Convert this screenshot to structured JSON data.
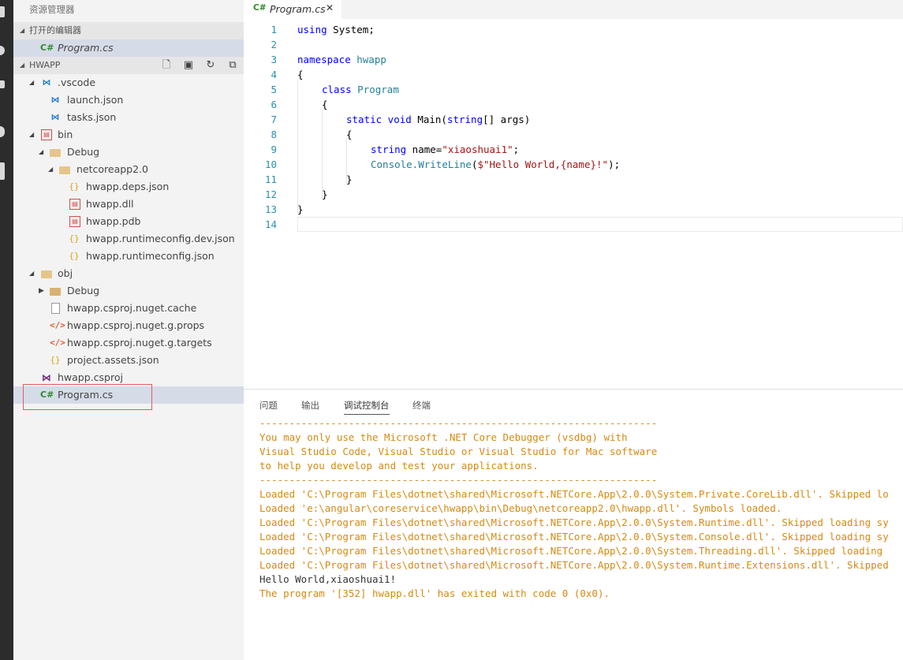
{
  "sidebar": {
    "title": "资源管理器",
    "open_editors": {
      "header": "打开的编辑器",
      "items": [
        {
          "label": "Program.cs"
        }
      ]
    },
    "project": {
      "header": "HWAPP",
      "tree": [
        {
          "label": ".vscode"
        },
        {
          "label": "launch.json"
        },
        {
          "label": "tasks.json"
        },
        {
          "label": "bin"
        },
        {
          "label": "Debug"
        },
        {
          "label": "netcoreapp2.0"
        },
        {
          "label": "hwapp.deps.json"
        },
        {
          "label": "hwapp.dll"
        },
        {
          "label": "hwapp.pdb"
        },
        {
          "label": "hwapp.runtimeconfig.dev.json"
        },
        {
          "label": "hwapp.runtimeconfig.json"
        },
        {
          "label": "obj"
        },
        {
          "label": "Debug"
        },
        {
          "label": "hwapp.csproj.nuget.cache"
        },
        {
          "label": "hwapp.csproj.nuget.g.props"
        },
        {
          "label": "hwapp.csproj.nuget.g.targets"
        },
        {
          "label": "project.assets.json"
        },
        {
          "label": "hwapp.csproj"
        },
        {
          "label": "Program.cs"
        }
      ]
    }
  },
  "editor": {
    "tab": {
      "label": "Program.cs",
      "icon": "C#",
      "close": "✕"
    },
    "line_numbers": [
      "1",
      "2",
      "3",
      "4",
      "5",
      "6",
      "7",
      "8",
      "9",
      "10",
      "11",
      "12",
      "13",
      "14"
    ],
    "code": {
      "l1_kw": "using",
      "l1_rest": " System;",
      "l3_kw": "namespace",
      "l3_rest": " hwapp",
      "l4": "{",
      "l5_kw": "class",
      "l5_type": " Program",
      "l6": "{",
      "l7_kw1": "static",
      "l7_kw2": " void",
      "l7_name": " Main(",
      "l7_kw3": "string",
      "l7_rest": "[] args)",
      "l8": "{",
      "l9_kw": "string",
      "l9_name": " name=",
      "l9_str": "\"xiaoshuai1\"",
      "l9_end": ";",
      "l10_obj": "Console.",
      "l10_method": "WriteLine",
      "l10_open": "(",
      "l10_str": "$\"Hello World,{name}!\"",
      "l10_end": ");",
      "l11": "}",
      "l12": "}",
      "l13": "}"
    }
  },
  "panel": {
    "tabs": [
      "问题",
      "输出",
      "调试控制台",
      "终端"
    ],
    "active_tab": "调试控制台",
    "output": [
      "-------------------------------------------------------------------",
      "You may only use the Microsoft .NET Core Debugger (vsdbg) with",
      "Visual Studio Code, Visual Studio or Visual Studio for Mac software",
      "to help you develop and test your applications.",
      "-------------------------------------------------------------------",
      "Loaded 'C:\\Program Files\\dotnet\\shared\\Microsoft.NETCore.App\\2.0.0\\System.Private.CoreLib.dll'. Skipped lo",
      "Loaded 'e:\\angular\\coreservice\\hwapp\\bin\\Debug\\netcoreapp2.0\\hwapp.dll'. Symbols loaded.",
      "Loaded 'C:\\Program Files\\dotnet\\shared\\Microsoft.NETCore.App\\2.0.0\\System.Runtime.dll'. Skipped loading sy",
      "Loaded 'C:\\Program Files\\dotnet\\shared\\Microsoft.NETCore.App\\2.0.0\\System.Console.dll'. Skipped loading sy",
      "Loaded 'C:\\Program Files\\dotnet\\shared\\Microsoft.NETCore.App\\2.0.0\\System.Threading.dll'. Skipped loading",
      "Loaded 'C:\\Program Files\\dotnet\\shared\\Microsoft.NETCore.App\\2.0.0\\System.Runtime.Extensions.dll'. Skipped",
      "Hello World,xiaoshuai1!",
      "The program '[352] hwapp.dll' has exited with code 0 (0x0)."
    ]
  },
  "colors": {
    "output_text": "#d58a14",
    "keyword": "#0000ff",
    "type": "#267f99",
    "string": "#a31515",
    "line_number": "#2b91af",
    "selection": "#d6dbe8",
    "highlight_box": "#e25c5c"
  }
}
